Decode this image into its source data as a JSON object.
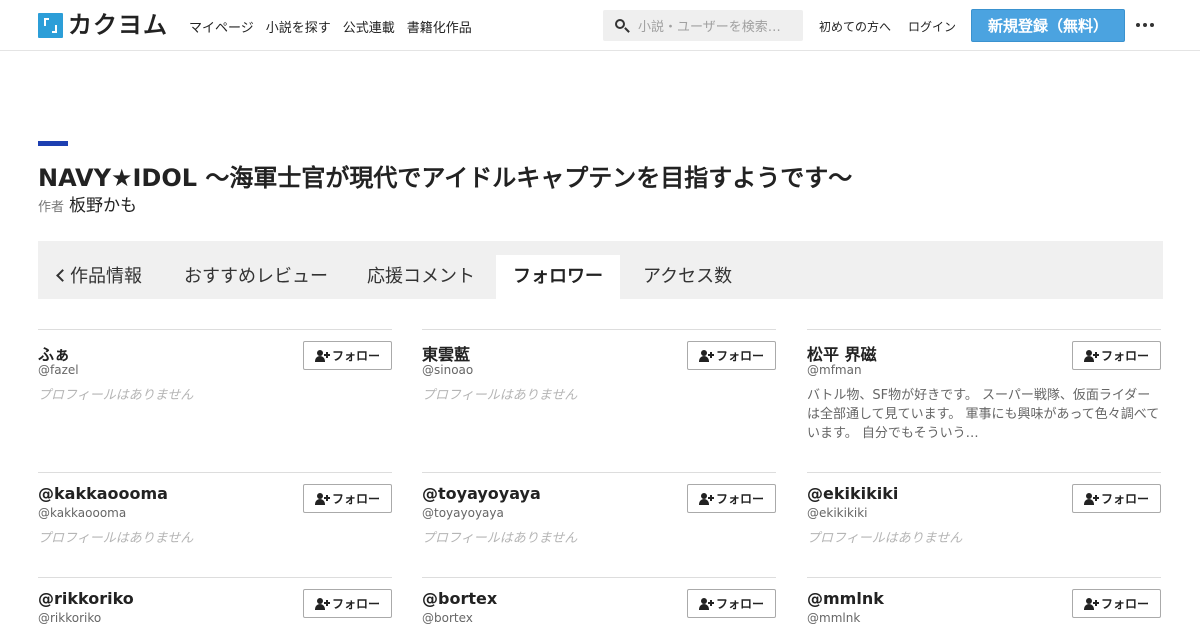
{
  "header": {
    "logo_text": "カクヨム",
    "nav": [
      "マイページ",
      "小説を探す",
      "公式連載",
      "書籍化作品"
    ],
    "search_placeholder": "小説・ユーザーを検索…",
    "first_time": "初めての方へ",
    "login": "ログイン",
    "signup": "新規登録（無料）"
  },
  "work": {
    "title": "NAVY★IDOL ～海軍士官が現代でアイドルキャプテンを目指すようです～",
    "author_label": "作者",
    "author_name": "板野かも"
  },
  "tabs": [
    "作品情報",
    "おすすめレビュー",
    "応援コメント",
    "フォロワー",
    "アクセス数"
  ],
  "active_tab": "フォロワー",
  "follow_label": "フォロー",
  "followers": [
    {
      "name": "ふぁ",
      "id": "@fazel",
      "bio": "プロフィールはありません"
    },
    {
      "name": "東雲藍",
      "id": "@sinoao",
      "bio": "プロフィールはありません"
    },
    {
      "name": "松平 界磁",
      "id": "@mfman",
      "bio": "バトル物、SF物が好きです。 スーパー戦隊、仮面ライダーは全部通して見ています。 軍事にも興味があって色々調べています。 自分でもそういう…"
    },
    {
      "name": "@kakkaoooma",
      "id": "@kakkaoooma",
      "bio": "プロフィールはありません"
    },
    {
      "name": "@toyayoyaya",
      "id": "@toyayoyaya",
      "bio": "プロフィールはありません"
    },
    {
      "name": "@ekikikiki",
      "id": "@ekikikiki",
      "bio": "プロフィールはありません"
    },
    {
      "name": "@rikkoriko",
      "id": "@rikkoriko",
      "bio": ""
    },
    {
      "name": "@bortex",
      "id": "@bortex",
      "bio": ""
    },
    {
      "name": "@mmlnk",
      "id": "@mmlnk",
      "bio": ""
    }
  ],
  "colors": {
    "accent": "#1d3fb1",
    "signup_button": "#4ba3e0",
    "logo": "#2c9ed8"
  }
}
